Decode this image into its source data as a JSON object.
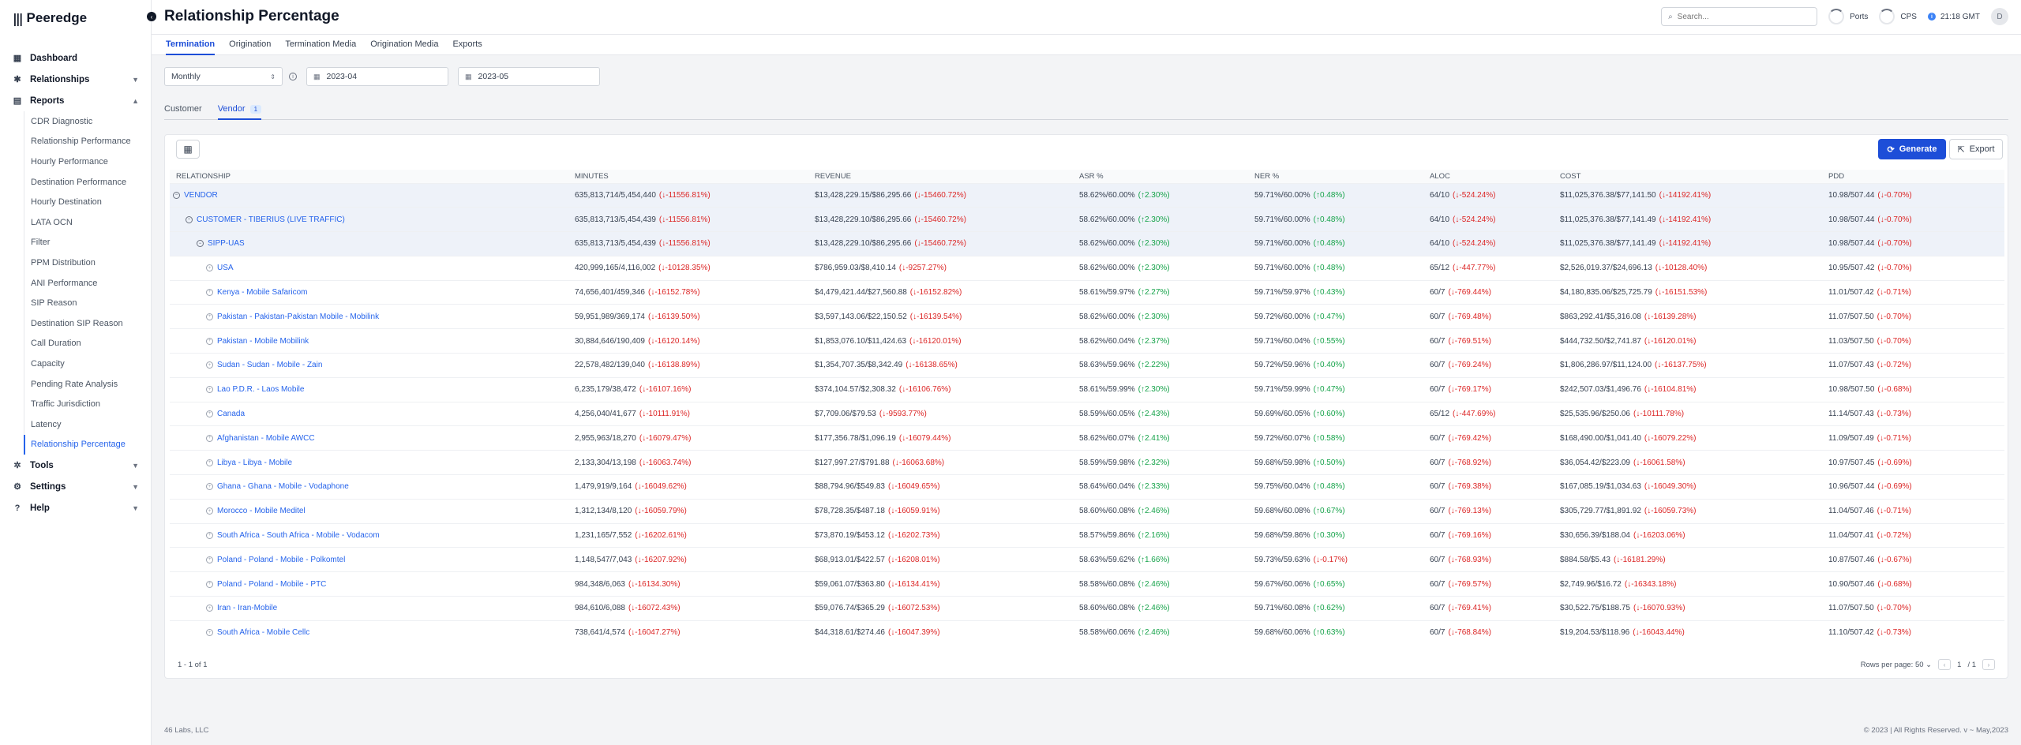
{
  "brand": {
    "logo": "Peeredge"
  },
  "header": {
    "title": "Relationship Percentage",
    "search_placeholder": "Search...",
    "ports_label": "Ports",
    "cps_label": "CPS",
    "time": "21:18 GMT",
    "avatar": "D"
  },
  "sidebar": {
    "dashboard": "Dashboard",
    "relationships": "Relationships",
    "reports": "Reports",
    "report_items": [
      "CDR Diagnostic",
      "Relationship Performance",
      "Hourly Performance",
      "Destination Performance",
      "Hourly Destination",
      "LATA OCN",
      "Filter",
      "PPM Distribution",
      "ANI Performance",
      "SIP Reason",
      "Destination SIP Reason",
      "Call Duration",
      "Capacity",
      "Pending Rate Analysis",
      "Traffic Jurisdiction",
      "Latency",
      "Relationship Percentage"
    ],
    "tools": "Tools",
    "settings": "Settings",
    "help": "Help"
  },
  "tabs": [
    "Termination",
    "Origination",
    "Termination Media",
    "Origination Media",
    "Exports"
  ],
  "filters": {
    "period": "Monthly",
    "from": "2023-04",
    "to": "2023-05"
  },
  "subtabs": {
    "customer": "Customer",
    "vendor": "Vendor",
    "vendor_count": "1"
  },
  "actions": {
    "generate": "Generate",
    "export": "Export"
  },
  "columns": [
    "RELATIONSHIP",
    "MINUTES",
    "REVENUE",
    "ASR %",
    "NER %",
    "ALOC",
    "COST",
    "PDD"
  ],
  "rows": [
    {
      "level": 0,
      "name": "VENDOR",
      "m": "635,813,714/5,454,440",
      "md": "(↓-11556.81%)",
      "r": "$13,428,229.15/$86,295.66",
      "rd": "(↓-15460.72%)",
      "a": "58.62%/60.00%",
      "ad": "(↑2.30%)",
      "n": "59.71%/60.00%",
      "nd": "(↑0.48%)",
      "l": "64/10",
      "ld": "(↓-524.24%)",
      "c": "$11,025,376.38/$77,141.50",
      "cd": "(↓-14192.41%)",
      "p": "10.98/507.44",
      "pd": "(↓-0.70%)"
    },
    {
      "level": 1,
      "name": "CUSTOMER - TIBERIUS (LIVE TRAFFIC)",
      "m": "635,813,713/5,454,439",
      "md": "(↓-11556.81%)",
      "r": "$13,428,229.10/$86,295.66",
      "rd": "(↓-15460.72%)",
      "a": "58.62%/60.00%",
      "ad": "(↑2.30%)",
      "n": "59.71%/60.00%",
      "nd": "(↑0.48%)",
      "l": "64/10",
      "ld": "(↓-524.24%)",
      "c": "$11,025,376.38/$77,141.49",
      "cd": "(↓-14192.41%)",
      "p": "10.98/507.44",
      "pd": "(↓-0.70%)"
    },
    {
      "level": 2,
      "name": "SIPP-UAS",
      "m": "635,813,713/5,454,439",
      "md": "(↓-11556.81%)",
      "r": "$13,428,229.10/$86,295.66",
      "rd": "(↓-15460.72%)",
      "a": "58.62%/60.00%",
      "ad": "(↑2.30%)",
      "n": "59.71%/60.00%",
      "nd": "(↑0.48%)",
      "l": "64/10",
      "ld": "(↓-524.24%)",
      "c": "$11,025,376.38/$77,141.49",
      "cd": "(↓-14192.41%)",
      "p": "10.98/507.44",
      "pd": "(↓-0.70%)"
    },
    {
      "level": 3,
      "name": "USA",
      "m": "420,999,165/4,116,002",
      "md": "(↓-10128.35%)",
      "r": "$786,959.03/$8,410.14",
      "rd": "(↓-9257.27%)",
      "a": "58.62%/60.00%",
      "ad": "(↑2.30%)",
      "n": "59.71%/60.00%",
      "nd": "(↑0.48%)",
      "l": "65/12",
      "ld": "(↓-447.77%)",
      "c": "$2,526,019.37/$24,696.13",
      "cd": "(↓-10128.40%)",
      "p": "10.95/507.42",
      "pd": "(↓-0.70%)"
    },
    {
      "level": 3,
      "name": "Kenya - Mobile Safaricom",
      "m": "74,656,401/459,346",
      "md": "(↓-16152.78%)",
      "r": "$4,479,421.44/$27,560.88",
      "rd": "(↓-16152.82%)",
      "a": "58.61%/59.97%",
      "ad": "(↑2.27%)",
      "n": "59.71%/59.97%",
      "nd": "(↑0.43%)",
      "l": "60/7",
      "ld": "(↓-769.44%)",
      "c": "$4,180,835.06/$25,725.79",
      "cd": "(↓-16151.53%)",
      "p": "11.01/507.42",
      "pd": "(↓-0.71%)"
    },
    {
      "level": 3,
      "name": "Pakistan - Pakistan-Pakistan Mobile - Mobilink",
      "m": "59,951,989/369,174",
      "md": "(↓-16139.50%)",
      "r": "$3,597,143.06/$22,150.52",
      "rd": "(↓-16139.54%)",
      "a": "58.62%/60.00%",
      "ad": "(↑2.30%)",
      "n": "59.72%/60.00%",
      "nd": "(↑0.47%)",
      "l": "60/7",
      "ld": "(↓-769.48%)",
      "c": "$863,292.41/$5,316.08",
      "cd": "(↓-16139.28%)",
      "p": "11.07/507.50",
      "pd": "(↓-0.70%)"
    },
    {
      "level": 3,
      "name": "Pakistan - Mobile Mobilink",
      "m": "30,884,646/190,409",
      "md": "(↓-16120.14%)",
      "r": "$1,853,076.10/$11,424.63",
      "rd": "(↓-16120.01%)",
      "a": "58.62%/60.04%",
      "ad": "(↑2.37%)",
      "n": "59.71%/60.04%",
      "nd": "(↑0.55%)",
      "l": "60/7",
      "ld": "(↓-769.51%)",
      "c": "$444,732.50/$2,741.87",
      "cd": "(↓-16120.01%)",
      "p": "11.03/507.50",
      "pd": "(↓-0.70%)"
    },
    {
      "level": 3,
      "name": "Sudan - Sudan - Mobile - Zain",
      "m": "22,578,482/139,040",
      "md": "(↓-16138.89%)",
      "r": "$1,354,707.35/$8,342.49",
      "rd": "(↓-16138.65%)",
      "a": "58.63%/59.96%",
      "ad": "(↑2.22%)",
      "n": "59.72%/59.96%",
      "nd": "(↑0.40%)",
      "l": "60/7",
      "ld": "(↓-769.24%)",
      "c": "$1,806,286.97/$11,124.00",
      "cd": "(↓-16137.75%)",
      "p": "11.07/507.43",
      "pd": "(↓-0.72%)"
    },
    {
      "level": 3,
      "name": "Lao P.D.R. - Laos Mobile",
      "m": "6,235,179/38,472",
      "md": "(↓-16107.16%)",
      "r": "$374,104.57/$2,308.32",
      "rd": "(↓-16106.76%)",
      "a": "58.61%/59.99%",
      "ad": "(↑2.30%)",
      "n": "59.71%/59.99%",
      "nd": "(↑0.47%)",
      "l": "60/7",
      "ld": "(↓-769.17%)",
      "c": "$242,507.03/$1,496.76",
      "cd": "(↓-16104.81%)",
      "p": "10.98/507.50",
      "pd": "(↓-0.68%)"
    },
    {
      "level": 3,
      "name": "Canada",
      "m": "4,256,040/41,677",
      "md": "(↓-10111.91%)",
      "r": "$7,709.06/$79.53",
      "rd": "(↓-9593.77%)",
      "a": "58.59%/60.05%",
      "ad": "(↑2.43%)",
      "n": "59.69%/60.05%",
      "nd": "(↑0.60%)",
      "l": "65/12",
      "ld": "(↓-447.69%)",
      "c": "$25,535.96/$250.06",
      "cd": "(↓-10111.78%)",
      "p": "11.14/507.43",
      "pd": "(↓-0.73%)"
    },
    {
      "level": 3,
      "name": "Afghanistan - Mobile AWCC",
      "m": "2,955,963/18,270",
      "md": "(↓-16079.47%)",
      "r": "$177,356.78/$1,096.19",
      "rd": "(↓-16079.44%)",
      "a": "58.62%/60.07%",
      "ad": "(↑2.41%)",
      "n": "59.72%/60.07%",
      "nd": "(↑0.58%)",
      "l": "60/7",
      "ld": "(↓-769.42%)",
      "c": "$168,490.00/$1,041.40",
      "cd": "(↓-16079.22%)",
      "p": "11.09/507.49",
      "pd": "(↓-0.71%)"
    },
    {
      "level": 3,
      "name": "Libya - Libya - Mobile",
      "m": "2,133,304/13,198",
      "md": "(↓-16063.74%)",
      "r": "$127,997.27/$791.88",
      "rd": "(↓-16063.68%)",
      "a": "58.59%/59.98%",
      "ad": "(↑2.32%)",
      "n": "59.68%/59.98%",
      "nd": "(↑0.50%)",
      "l": "60/7",
      "ld": "(↓-768.92%)",
      "c": "$36,054.42/$223.09",
      "cd": "(↓-16061.58%)",
      "p": "10.97/507.45",
      "pd": "(↓-0.69%)"
    },
    {
      "level": 3,
      "name": "Ghana - Ghana - Mobile - Vodaphone",
      "m": "1,479,919/9,164",
      "md": "(↓-16049.62%)",
      "r": "$88,794.96/$549.83",
      "rd": "(↓-16049.65%)",
      "a": "58.64%/60.04%",
      "ad": "(↑2.33%)",
      "n": "59.75%/60.04%",
      "nd": "(↑0.48%)",
      "l": "60/7",
      "ld": "(↓-769.38%)",
      "c": "$167,085.19/$1,034.63",
      "cd": "(↓-16049.30%)",
      "p": "10.96/507.44",
      "pd": "(↓-0.69%)"
    },
    {
      "level": 3,
      "name": "Morocco - Mobile Meditel",
      "m": "1,312,134/8,120",
      "md": "(↓-16059.79%)",
      "r": "$78,728.35/$487.18",
      "rd": "(↓-16059.91%)",
      "a": "58.60%/60.08%",
      "ad": "(↑2.46%)",
      "n": "59.68%/60.08%",
      "nd": "(↑0.67%)",
      "l": "60/7",
      "ld": "(↓-769.13%)",
      "c": "$305,729.77/$1,891.92",
      "cd": "(↓-16059.73%)",
      "p": "11.04/507.46",
      "pd": "(↓-0.71%)"
    },
    {
      "level": 3,
      "name": "South Africa - South Africa - Mobile - Vodacom",
      "m": "1,231,165/7,552",
      "md": "(↓-16202.61%)",
      "r": "$73,870.19/$453.12",
      "rd": "(↓-16202.73%)",
      "a": "58.57%/59.86%",
      "ad": "(↑2.16%)",
      "n": "59.68%/59.86%",
      "nd": "(↑0.30%)",
      "l": "60/7",
      "ld": "(↓-769.16%)",
      "c": "$30,656.39/$188.04",
      "cd": "(↓-16203.06%)",
      "p": "11.04/507.41",
      "pd": "(↓-0.72%)"
    },
    {
      "level": 3,
      "name": "Poland - Poland - Mobile - Polkomtel",
      "m": "1,148,547/7,043",
      "md": "(↓-16207.92%)",
      "r": "$68,913.01/$422.57",
      "rd": "(↓-16208.01%)",
      "a": "58.63%/59.62%",
      "ad": "(↑1.66%)",
      "n": "59.73%/59.63%",
      "nd": "(↓-0.17%)",
      "l": "60/7",
      "ld": "(↓-768.93%)",
      "c": "$884.58/$5.43",
      "cd": "(↓-16181.29%)",
      "p": "10.87/507.46",
      "pd": "(↓-0.67%)"
    },
    {
      "level": 3,
      "name": "Poland - Poland - Mobile - PTC",
      "m": "984,348/6,063",
      "md": "(↓-16134.30%)",
      "r": "$59,061.07/$363.80",
      "rd": "(↓-16134.41%)",
      "a": "58.58%/60.08%",
      "ad": "(↑2.46%)",
      "n": "59.67%/60.06%",
      "nd": "(↑0.65%)",
      "l": "60/7",
      "ld": "(↓-769.57%)",
      "c": "$2,749.96/$16.72",
      "cd": "(↓-16343.18%)",
      "p": "10.90/507.46",
      "pd": "(↓-0.68%)"
    },
    {
      "level": 3,
      "name": "Iran - Iran-Mobile",
      "m": "984,610/6,088",
      "md": "(↓-16072.43%)",
      "r": "$59,076.74/$365.29",
      "rd": "(↓-16072.53%)",
      "a": "58.60%/60.08%",
      "ad": "(↑2.46%)",
      "n": "59.71%/60.08%",
      "nd": "(↑0.62%)",
      "l": "60/7",
      "ld": "(↓-769.41%)",
      "c": "$30,522.75/$188.75",
      "cd": "(↓-16070.93%)",
      "p": "11.07/507.50",
      "pd": "(↓-0.70%)"
    },
    {
      "level": 3,
      "name": "South Africa - Mobile Cellc",
      "m": "738,641/4,574",
      "md": "(↓-16047.27%)",
      "r": "$44,318.61/$274.46",
      "rd": "(↓-16047.39%)",
      "a": "58.58%/60.06%",
      "ad": "(↑2.46%)",
      "n": "59.68%/60.06%",
      "nd": "(↑0.63%)",
      "l": "60/7",
      "ld": "(↓-768.84%)",
      "c": "$19,204.53/$118.96",
      "cd": "(↓-16043.44%)",
      "p": "11.10/507.42",
      "pd": "(↓-0.73%)"
    }
  ],
  "table_footer": {
    "count": "1 - 1 of 1",
    "rows_per_page": "Rows per page: 50",
    "page": "1",
    "pages": "/ 1"
  },
  "footer": {
    "left": "46 Labs, LLC",
    "right": "© 2023 | All Rights Reserved. v ~ May,2023"
  }
}
